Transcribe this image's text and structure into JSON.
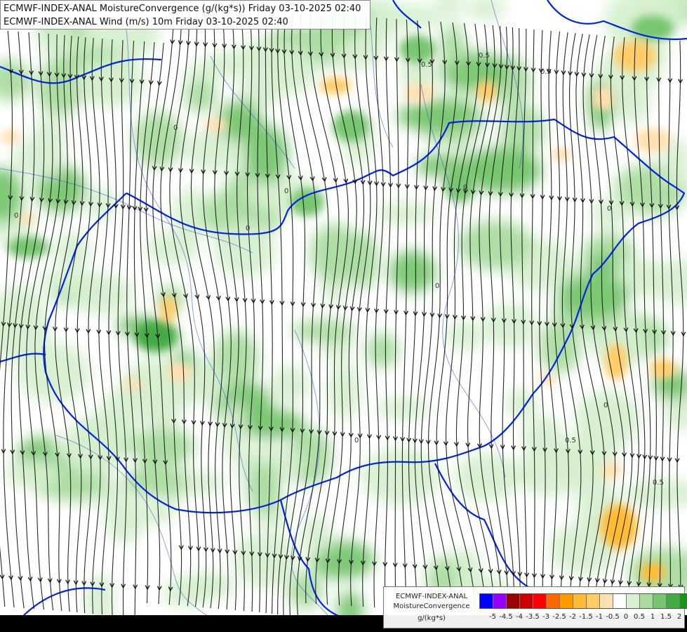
{
  "header": {
    "line1": "ECMWF-INDEX-ANAL MoistureConvergence (g/(kg*s)) Friday 03-10-2025 02:40",
    "line2": "ECMWF-INDEX-ANAL Wind (m/s) 10m Friday 03-10-2025 02:40"
  },
  "legend": {
    "model": "ECMWF-INDEX-ANAL",
    "variable": "MoistureConvergence",
    "units": "g/(kg*s)",
    "colors": [
      "#0000ff",
      "#9900ff",
      "#990000",
      "#cc0000",
      "#ff0000",
      "#ff6600",
      "#ff9900",
      "#ffbb33",
      "#ffcc66",
      "#ffe0b0",
      "#ffffff",
      "#d6f0d0",
      "#aadca0",
      "#77c66f",
      "#44aa44",
      "#119911"
    ],
    "ticks": [
      "-5",
      "-4.5",
      "-4",
      "-3.5",
      "-3",
      "-2.5",
      "-2",
      "-1.5",
      "-1",
      "-0.5",
      "0",
      "0.5",
      "1",
      "1.5",
      "2"
    ]
  },
  "map": {
    "contour_labels": [
      "0",
      "0",
      "0",
      "0",
      "0",
      "0",
      "0",
      "0",
      "0",
      "0.5",
      "0.5",
      "0.5",
      "0.5",
      "0.5"
    ],
    "field_colors": {
      "light_green": "#d6f0d0",
      "mid_green": "#aadca0",
      "dark_green": "#77c66f",
      "deep_green": "#44aa44",
      "light_orange": "#ffe0b0",
      "orange": "#ffcc66",
      "strong_orange": "#ffbb33",
      "border": "#0022ee",
      "river": "#3355dd",
      "streamline": "#111111"
    }
  }
}
